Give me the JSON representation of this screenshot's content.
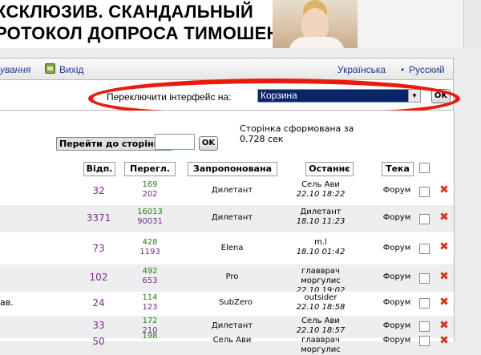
{
  "banner": {
    "line1": "КСКЛЮЗИВ. СКАНДАЛЬНЫЙ",
    "line2": "РОТОКОЛ ДОПРОСА ТИМОШЕНКО"
  },
  "nav": {
    "left_link": "ування",
    "exit_label": "Вихід",
    "lang_uk": "Українська",
    "lang_sep": "•",
    "lang_ru": "Русский"
  },
  "switcher": {
    "label": "Переключити інтерфейс на:",
    "selected": "Корзина",
    "ok": "OK",
    "highlight_color": "#e91b0c"
  },
  "goto": {
    "label": "Перейти до сторінки:",
    "input_value": "",
    "ok": "OK"
  },
  "generated": {
    "line1": "Сторінка сформована за",
    "line2": "0.728 сек"
  },
  "table": {
    "headers": {
      "replies": "Відп.",
      "views": "Перегл.",
      "proposed": "Запропонована",
      "last": "Останнє",
      "topic": "Тека"
    },
    "rows": [
      {
        "title": "",
        "replies": "32",
        "views_green": "169",
        "views_purple": "202",
        "proposed": "Дилетант",
        "last_user": "Сель Ави",
        "last_date": "22.10 18:22",
        "topic": "Форум"
      },
      {
        "title": "",
        "replies": "3371",
        "views_green": "16013",
        "views_purple": "90031",
        "proposed": "Дилетант",
        "last_user": "Дилетант",
        "last_date": "18.10 11:23",
        "topic": "Форум"
      },
      {
        "title": "",
        "replies": "73",
        "views_green": "428",
        "views_purple": "1193",
        "proposed": "Elena",
        "last_user": "m.l",
        "last_date": "18.10 01:42",
        "topic": "Форум"
      },
      {
        "title": "",
        "replies": "102",
        "views_green": "492",
        "views_purple": "653",
        "proposed": "Pro",
        "last_user": "главврач моргулис",
        "last_date": "22.10 19:02",
        "topic": "Форум"
      },
      {
        "title": "ав.",
        "replies": "24",
        "views_green": "114",
        "views_purple": "123",
        "proposed": "SubZero",
        "last_user": "outsider",
        "last_date": "22.10 18:58",
        "topic": "Форум"
      },
      {
        "title": "",
        "replies": "33",
        "views_green": "172",
        "views_purple": "210",
        "proposed": "Дилетант",
        "last_user": "Сель Ави",
        "last_date": "22.10 18:57",
        "topic": "Форум"
      },
      {
        "title": "",
        "replies": "50",
        "views_green": "198",
        "views_purple": "",
        "proposed": "Сель Ави",
        "last_user": "главврач моргулис",
        "last_date": "",
        "topic": "Форум"
      }
    ]
  },
  "icons": {
    "delete": "delete-x-icon",
    "exit": "exit-door-icon",
    "dropdown": "dropdown-arrow-icon"
  },
  "colors": {
    "views_new": "#2e7d1a",
    "views_total": "#6c2a8c",
    "replies": "#7a2a8a",
    "delete": "#d8321e",
    "selected_bg": "#0a246a"
  }
}
